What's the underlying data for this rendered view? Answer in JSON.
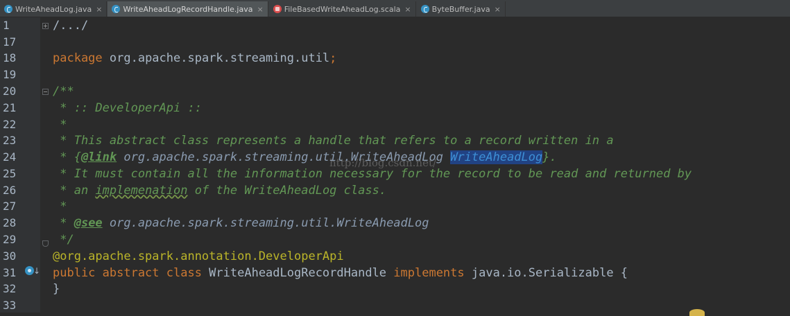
{
  "tabs": [
    {
      "label": "WriteAheadLog.java",
      "kind": "java",
      "active": false
    },
    {
      "label": "WriteAheadLogRecordHandle.java",
      "kind": "java",
      "active": true
    },
    {
      "label": "FileBasedWriteAheadLog.scala",
      "kind": "scala",
      "active": false
    },
    {
      "label": "ByteBuffer.java",
      "kind": "java",
      "active": false
    }
  ],
  "tab_close_glyph": "×",
  "lines": [
    "1",
    "17",
    "18",
    "19",
    "20",
    "21",
    "22",
    "23",
    "24",
    "25",
    "26",
    "27",
    "28",
    "29",
    "30",
    "31",
    "32",
    "33"
  ],
  "code": {
    "l1": "/.../",
    "l18_kw": "package",
    "l18_rest": " org.apache.spark.streaming.util",
    "l18_semi": ";",
    "l20": "/**",
    "l21": " * :: DeveloperApi ::",
    "l22": " *",
    "l23": " * This abstract class represents a handle that refers to a record written in a",
    "l24_a": " * {",
    "l24_tag": "@link",
    "l24_ref": " org.apache.spark.streaming.util.WriteAheadLog ",
    "l24_sel": "WriteAheadLog",
    "l24_end": "}.",
    "l25": " * It must contain all the information necessary for the record to be read and returned by",
    "l26_a": " * an ",
    "l26_typo": "implemenation",
    "l26_b": " of the WriteAheadLog class.",
    "l27": " *",
    "l28_a": " * ",
    "l28_tag": "@see",
    "l28_ref": " org.apache.spark.streaming.util.WriteAheadLog",
    "l29": " */",
    "l30": "@org.apache.spark.annotation.DeveloperApi",
    "l31_kw1": "public abstract class",
    "l31_name": " WriteAheadLogRecordHandle ",
    "l31_kw2": "implements",
    "l31_rest": " java.io.Serializable {",
    "l32": "}"
  },
  "watermark": "http://blog.csdn.net/",
  "implement_arrow": "↓"
}
